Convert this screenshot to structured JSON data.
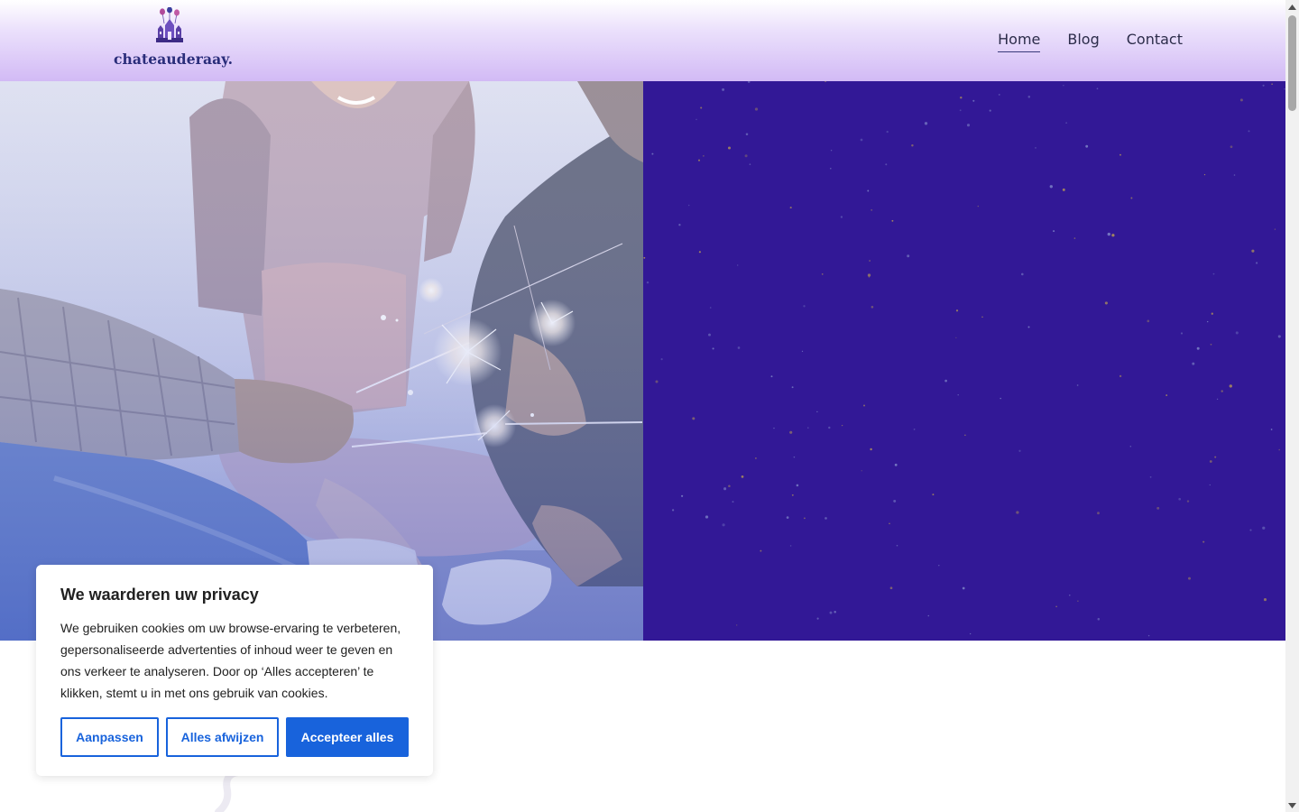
{
  "header": {
    "logo_text": "chateauderaay.",
    "nav": [
      {
        "label": "Home",
        "active": true
      },
      {
        "label": "Blog",
        "active": false
      },
      {
        "label": "Contact",
        "active": false
      }
    ]
  },
  "cookie_banner": {
    "title": "We waarderen uw privacy",
    "text": "We gebruiken cookies om uw browse-ervaring te verbeteren, gepersonaliseerde advertenties of inhoud weer te geven en ons verkeer te analyseren. Door op ‘Alles accepteren’ te klikken, stemt u in met ons gebruik van cookies.",
    "buttons": {
      "customize": "Aanpassen",
      "reject": "Alles afwijzen",
      "accept": "Accepteer alles"
    }
  },
  "colors": {
    "nav_text": "#2c2c4a",
    "logo_text": "#2a2d7a",
    "night_panel": "#321896",
    "cookie_button": "#1863dc"
  },
  "icons": {
    "logo_mark": "castle-with-balloons-icon",
    "scroll_up": "scroll-up-arrow-icon",
    "scroll_down": "scroll-down-arrow-icon"
  }
}
